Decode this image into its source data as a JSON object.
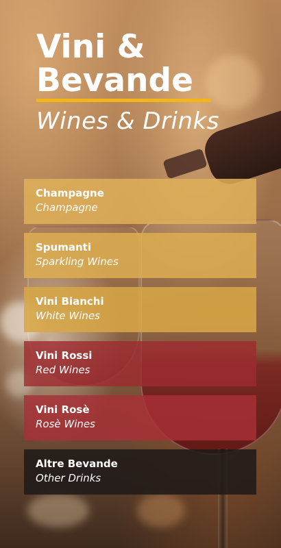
{
  "header": {
    "title_line1": "Vini &",
    "title_line2": "Bevande",
    "subtitle": "Wines & Drinks"
  },
  "menu": {
    "items": [
      {
        "it": "Champagne",
        "en": "Champagne",
        "color": "#DEB058"
      },
      {
        "it": "Spumanti",
        "en": "Sparkling Wines",
        "color": "#DDAE52"
      },
      {
        "it": "Vini Bianchi",
        "en": "White Wines",
        "color": "#D7A646"
      },
      {
        "it": "Vini Rossi",
        "en": "Red Wines",
        "color": "#9E2A30"
      },
      {
        "it": "Vini Rosè",
        "en": "Rosè Wines",
        "color": "#A83036"
      },
      {
        "it": "Altre Bevande",
        "en": "Other Drinks",
        "color": "#1E1A18"
      }
    ]
  },
  "colors": {
    "accent_underline": "#F2B51A",
    "text": "#FFFFFF"
  }
}
